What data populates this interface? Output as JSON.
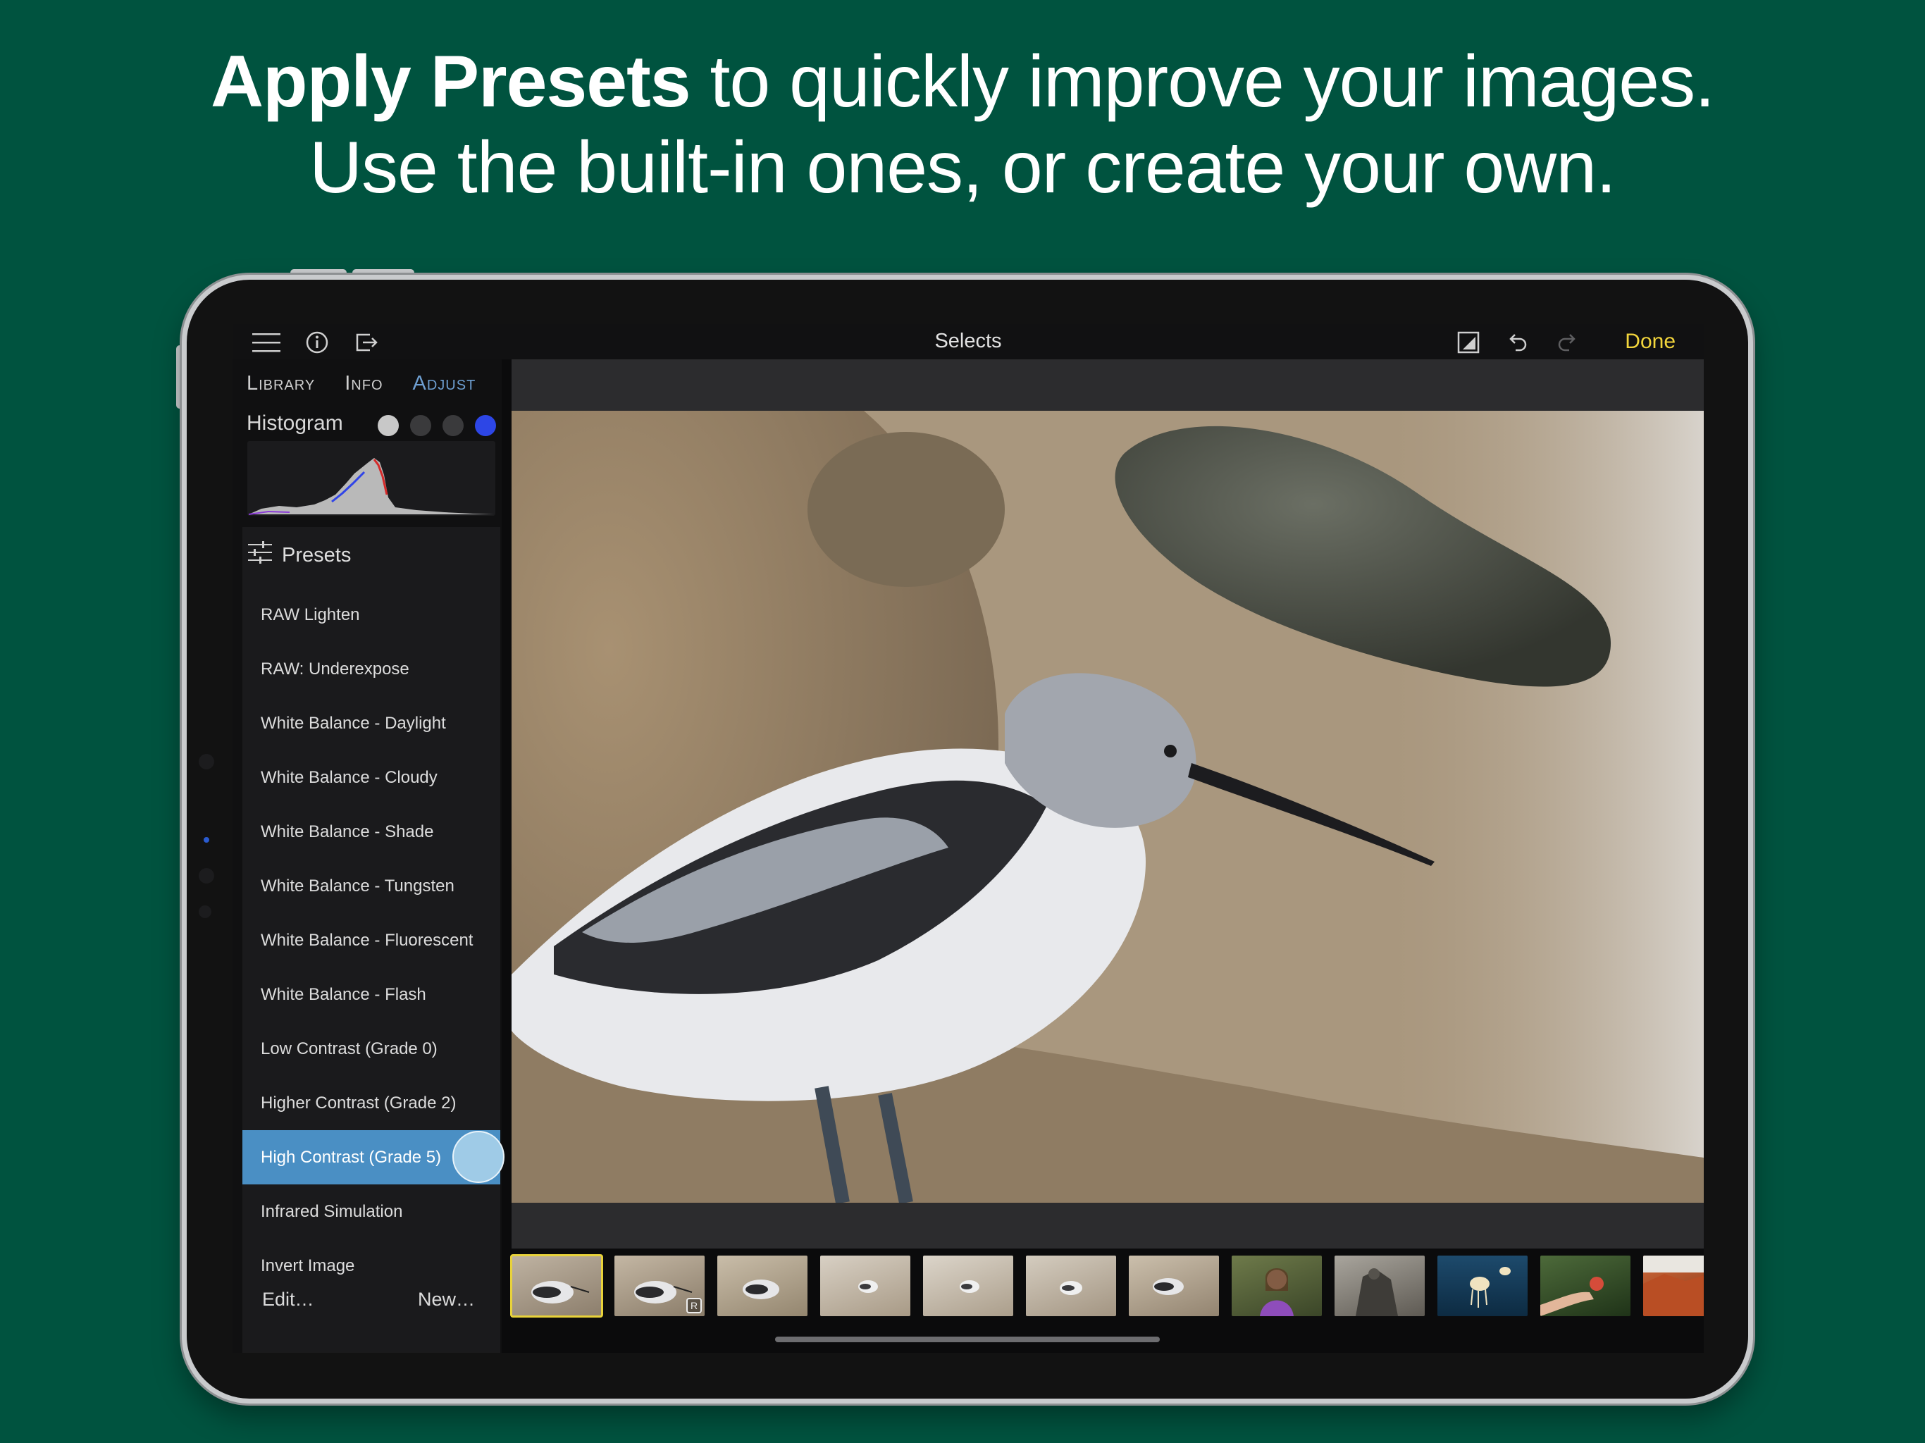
{
  "headline": {
    "line1_bold": "Apply Presets",
    "line1_rest": " to quickly improve your images.",
    "line2": "Use the built-in ones, or create your own."
  },
  "app": {
    "title": "Selects",
    "done_label": "Done",
    "icons": {
      "menu": "hamburger-menu-icon",
      "info": "info-circle-icon",
      "share": "share-export-icon",
      "compare": "compare-before-after-icon",
      "undo": "undo-icon",
      "redo": "redo-icon"
    }
  },
  "sidebar": {
    "tabs": [
      {
        "label": "Library",
        "active": false
      },
      {
        "label": "Info",
        "active": false
      },
      {
        "label": "Adjust",
        "active": true
      }
    ],
    "histogram_label": "Histogram",
    "histogram_swatches": [
      "#c8c8c8",
      "#3a3a3c",
      "#3a3a3c",
      "#2d46e6"
    ],
    "presets_label": "Presets",
    "presets": [
      {
        "label": "RAW Lighten",
        "selected": false
      },
      {
        "label": "RAW: Underexpose",
        "selected": false
      },
      {
        "label": "White Balance - Daylight",
        "selected": false
      },
      {
        "label": "White Balance - Cloudy",
        "selected": false
      },
      {
        "label": "White Balance - Shade",
        "selected": false
      },
      {
        "label": "White Balance - Tungsten",
        "selected": false
      },
      {
        "label": "White Balance - Fluorescent",
        "selected": false
      },
      {
        "label": "White Balance - Flash",
        "selected": false
      },
      {
        "label": "Low Contrast (Grade 0)",
        "selected": false
      },
      {
        "label": "Higher Contrast (Grade 2)",
        "selected": false
      },
      {
        "label": "High Contrast (Grade 5)",
        "selected": true
      },
      {
        "label": "Infrared Simulation",
        "selected": false
      },
      {
        "label": "Invert Image",
        "selected": false
      }
    ],
    "edit_label": "Edit…",
    "new_label": "New…"
  },
  "filmstrip": {
    "thumbnails": [
      {
        "scene": "bird-on-sand",
        "current": true,
        "raw_badge": ""
      },
      {
        "scene": "bird-on-sand",
        "current": false,
        "raw_badge": "R"
      },
      {
        "scene": "bird-on-sand",
        "current": false,
        "raw_badge": ""
      },
      {
        "scene": "bird-light",
        "current": false,
        "raw_badge": ""
      },
      {
        "scene": "bird-light",
        "current": false,
        "raw_badge": ""
      },
      {
        "scene": "bird-light",
        "current": false,
        "raw_badge": ""
      },
      {
        "scene": "bird-on-sand",
        "current": false,
        "raw_badge": ""
      },
      {
        "scene": "girl-purple",
        "current": false,
        "raw_badge": ""
      },
      {
        "scene": "statue",
        "current": false,
        "raw_badge": ""
      },
      {
        "scene": "jellyfish",
        "current": false,
        "raw_badge": ""
      },
      {
        "scene": "hand-flower",
        "current": false,
        "raw_badge": ""
      },
      {
        "scene": "red-rocks",
        "current": false,
        "raw_badge": ""
      }
    ]
  },
  "colors": {
    "background": "#00533f",
    "accent_done": "#f2d53c",
    "selected_row": "#4a8fc4",
    "active_tab": "#6e9fd1"
  }
}
